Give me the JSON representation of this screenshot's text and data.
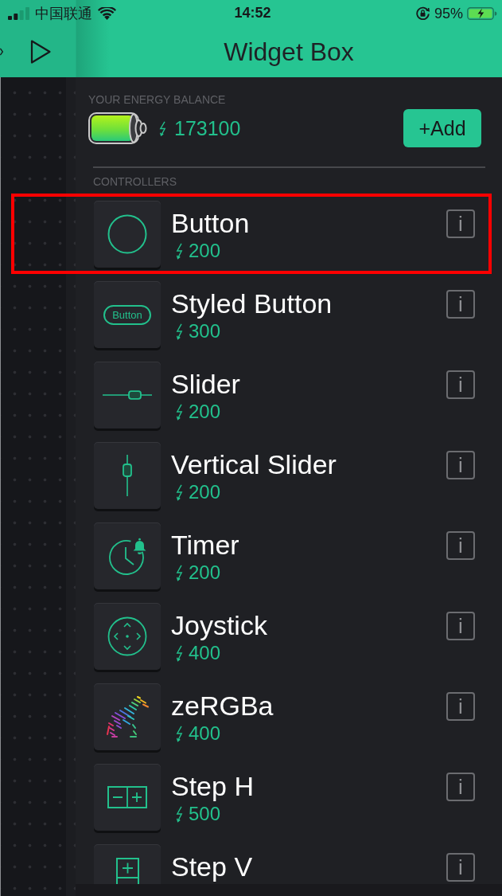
{
  "status_bar": {
    "carrier": "中国联通",
    "time": "14:52",
    "battery_percent": "95%",
    "charging": true
  },
  "header": {
    "title": "Widget Box"
  },
  "energy": {
    "label": "YOUR ENERGY BALANCE",
    "balance": "173100",
    "add_button": "+Add"
  },
  "controllers": {
    "heading": "CONTROLLERS",
    "items": [
      {
        "kind": "button",
        "name": "Button",
        "cost": "200",
        "info_button": "i",
        "highlighted": true
      },
      {
        "kind": "styled_button",
        "preview_label": "Button",
        "name": "Styled Button",
        "cost": "300",
        "info_button": "i",
        "highlighted": false
      },
      {
        "kind": "slider",
        "name": "Slider",
        "cost": "200",
        "info_button": "i",
        "highlighted": false
      },
      {
        "kind": "vertical_slider",
        "name": "Vertical Slider",
        "cost": "200",
        "info_button": "i",
        "highlighted": false
      },
      {
        "kind": "timer",
        "name": "Timer",
        "cost": "200",
        "info_button": "i",
        "highlighted": false
      },
      {
        "kind": "joystick",
        "name": "Joystick",
        "cost": "400",
        "info_button": "i",
        "highlighted": false
      },
      {
        "kind": "zergba",
        "name": "zeRGBa",
        "cost": "400",
        "info_button": "i",
        "highlighted": false
      },
      {
        "kind": "step_h",
        "name": "Step H",
        "cost": "500",
        "info_button": "i",
        "highlighted": false
      },
      {
        "kind": "step_v",
        "name": "Step V",
        "info_button": "i",
        "highlighted": false
      }
    ]
  }
}
